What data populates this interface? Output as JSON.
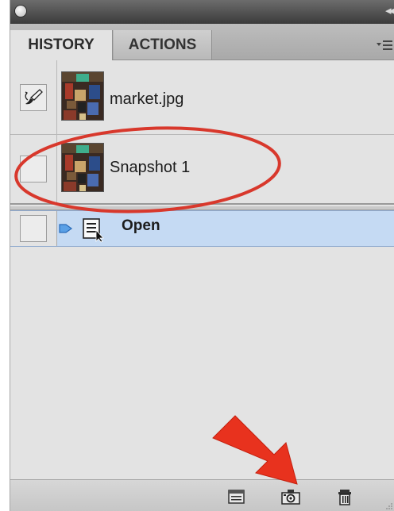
{
  "panel": {
    "tabs": [
      {
        "label": "HISTORY",
        "active": true
      },
      {
        "label": "ACTIONS",
        "active": false
      }
    ]
  },
  "history": {
    "items": [
      {
        "label": "market.jpg",
        "type": "snapshot",
        "history_brush_source": true
      },
      {
        "label": "Snapshot 1",
        "type": "snapshot",
        "history_brush_source": false
      },
      {
        "label": "Open",
        "type": "state",
        "selected": true
      }
    ]
  },
  "bottom_bar": {
    "icons": [
      "new-document-from-state-icon",
      "create-snapshot-icon",
      "delete-icon"
    ]
  },
  "annotations": {
    "ellipse_color": "#d8382c",
    "arrow_color": "#e8321e"
  },
  "colors": {
    "panel_bg": "#e3e3e3",
    "selected_row": "#c5daf3",
    "titlebar": "#4a4a4a"
  }
}
